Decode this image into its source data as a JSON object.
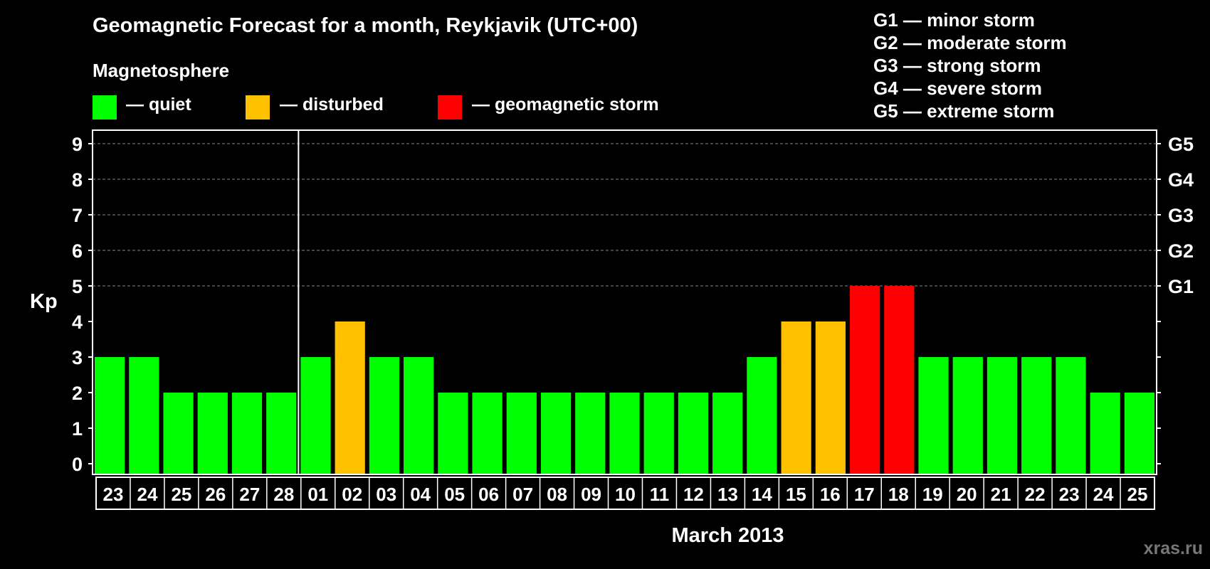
{
  "title": "Geomagnetic Forecast for a month, Reykjavik (UTC+00)",
  "magnetosphere_label": "Magnetosphere",
  "legend": [
    {
      "label": "— quiet",
      "color": "#00ff00"
    },
    {
      "label": "— disturbed",
      "color": "#ffc000"
    },
    {
      "label": "— geomagnetic storm",
      "color": "#ff0000"
    }
  ],
  "g_levels": [
    "G1 — minor storm",
    "G2 — moderate storm",
    "G3 — strong storm",
    "G4 — severe storm",
    "G5 — extreme storm"
  ],
  "month_label": "March 2013",
  "watermark": "xras.ru",
  "chart_data": {
    "type": "bar",
    "ylabel": "Kp",
    "xlabel": "March 2013",
    "ylim": [
      0,
      9
    ],
    "yticks": [
      0,
      1,
      2,
      3,
      4,
      5,
      6,
      7,
      8,
      9
    ],
    "right_axis_ticks": [
      {
        "kp": 5,
        "label": "G1"
      },
      {
        "kp": 6,
        "label": "G2"
      },
      {
        "kp": 7,
        "label": "G3"
      },
      {
        "kp": 8,
        "label": "G4"
      },
      {
        "kp": 9,
        "label": "G5"
      }
    ],
    "grid": "dashed horizontal at Kp 5-9",
    "month_separator_after_index": 5,
    "categories": [
      "23",
      "24",
      "25",
      "26",
      "27",
      "28",
      "01",
      "02",
      "03",
      "04",
      "05",
      "06",
      "07",
      "08",
      "09",
      "10",
      "11",
      "12",
      "13",
      "14",
      "15",
      "16",
      "17",
      "18",
      "19",
      "20",
      "21",
      "22",
      "23",
      "24",
      "25"
    ],
    "values": [
      3,
      3,
      2,
      2,
      2,
      2,
      3,
      4,
      3,
      3,
      2,
      2,
      2,
      2,
      2,
      2,
      2,
      2,
      2,
      3,
      4,
      4,
      5,
      5,
      3,
      3,
      3,
      3,
      3,
      2,
      2
    ],
    "level_colors": {
      "quiet": "#00ff00",
      "disturbed": "#ffc000",
      "storm": "#ff0000"
    }
  }
}
